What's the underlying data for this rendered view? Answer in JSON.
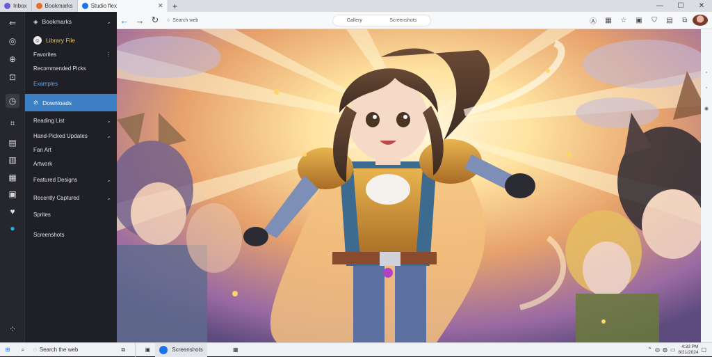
{
  "tabs": [
    {
      "label": "Inbox",
      "active": false,
      "favicon_color": "#6b5bd6"
    },
    {
      "label": "Bookmarks",
      "active": false,
      "favicon_color": "#e3702f"
    },
    {
      "label": "Studio flex",
      "active": true,
      "favicon_color": "#1a73e8"
    }
  ],
  "sidebar": {
    "header_label": "Bookmarks",
    "account_label": "Library  File",
    "items": [
      {
        "label": "Favorites",
        "chevron": false,
        "style": "normal"
      },
      {
        "label": "Recommended Picks",
        "chevron": false,
        "style": "normal"
      },
      {
        "label": "Examples",
        "chevron": false,
        "style": "blue"
      },
      {
        "label": "Downloads",
        "chevron": false,
        "style": "highlight"
      },
      {
        "label": "Reading List",
        "chevron": true,
        "style": "normal"
      },
      {
        "label": "Hand-Picked Updates",
        "chevron": true,
        "style": "normal"
      },
      {
        "label": "Fan Art",
        "chevron": false,
        "style": "normal"
      },
      {
        "label": "Artwork",
        "chevron": false,
        "style": "normal"
      },
      {
        "label": "Featured Designs",
        "chevron": true,
        "style": "normal"
      },
      {
        "label": "Recently Captured",
        "chevron": true,
        "style": "normal"
      },
      {
        "label": "Sprites",
        "chevron": false,
        "style": "normal"
      },
      {
        "label": "Screenshots",
        "chevron": false,
        "style": "normal"
      }
    ]
  },
  "toolbar": {
    "url_text": "Search web",
    "center_left": "Gallery",
    "center_right": "Screenshots"
  },
  "taskbar": {
    "search_label": "Search the web",
    "app_label": "Screenshots",
    "time": "4:33 PM",
    "date": "8/21/2024"
  },
  "colors": {
    "accent": "#3d7fc4",
    "sidebar_bg": "#1f2025"
  }
}
